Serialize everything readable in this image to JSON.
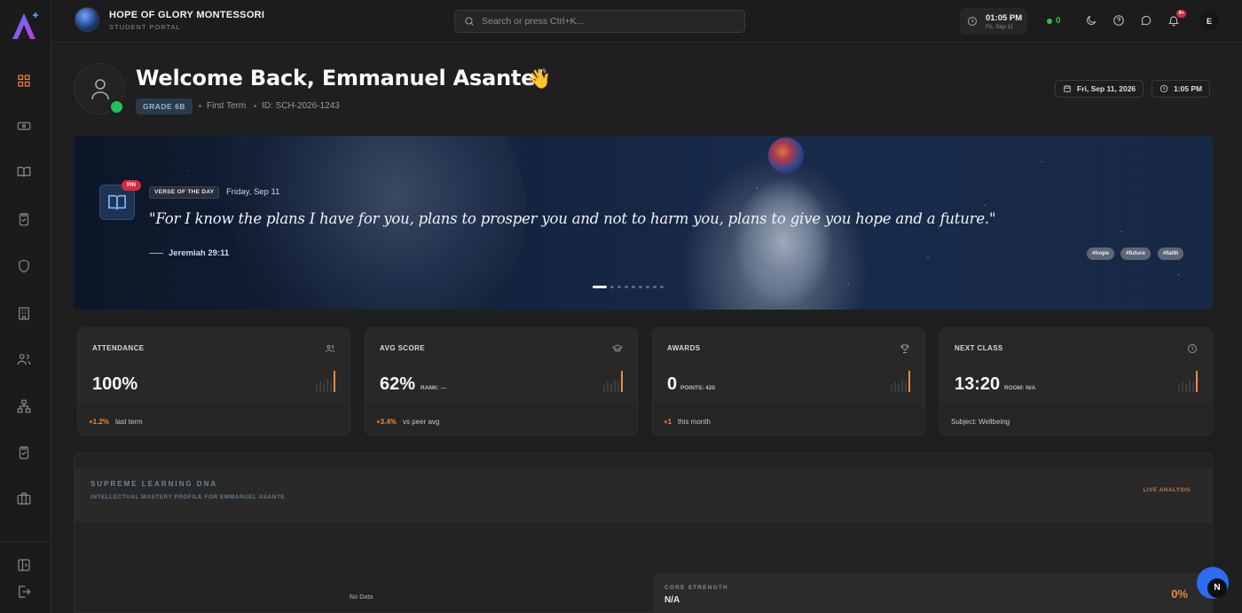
{
  "school": {
    "name": "HOPE OF GLORY MONTESSORI",
    "subtitle": "STUDENT PORTAL"
  },
  "search": {
    "placeholder": "Search or press Ctrl+K..."
  },
  "clock": {
    "time": "01:05 PM",
    "date": "Fri, Sep 11"
  },
  "online": {
    "count": "0"
  },
  "notifications": {
    "badge": "9+"
  },
  "user": {
    "initial": "E"
  },
  "welcome": {
    "greeting": "Welcome Back, Emmanuel Asante!",
    "emoji": "👋",
    "grade": "GRADE 6B",
    "term": "First Term",
    "student_id": "ID: SCH-2026-1243",
    "date_pill": "Fri, Sep 11, 2026",
    "time_pill": "1:05 PM"
  },
  "verse": {
    "pin": "PIN",
    "tag": "VERSE OF THE DAY",
    "date": "Friday, Sep 11",
    "text": "\"For I know the plans I have for you, plans to prosper you and not to harm you, plans to give you hope and a future.\"",
    "reference": "Jeremiah 29:11",
    "hashtags": [
      "#hope",
      "#future",
      "#faith"
    ],
    "slide_count": 9,
    "active_slide": 0
  },
  "stats": [
    {
      "title": "ATTENDANCE",
      "icon": "users-icon",
      "value": "100%",
      "sub": "",
      "delta": "+1.2%",
      "delta_label": "last term"
    },
    {
      "title": "AVG SCORE",
      "icon": "graduation-cap-icon",
      "value": "62%",
      "sub": "RANK: —",
      "delta": "+3.4%",
      "delta_label": "vs peer avg"
    },
    {
      "title": "AWARDS",
      "icon": "trophy-icon",
      "value": "0",
      "sub": "POINTS: 420",
      "delta": "+1",
      "delta_label": "this month"
    },
    {
      "title": "NEXT CLASS",
      "icon": "clock-icon",
      "value": "13:20",
      "sub": "ROOM: N/A",
      "footer": "Subject: Wellbeing"
    }
  ],
  "dna": {
    "title": "SUPREME LEARNING DNA",
    "subtitle": "INTELLECTUAL MASTERY PROFILE FOR EMMANUEL ASANTE",
    "live": "LIVE ANALYSIS",
    "no_data": "No Data",
    "core_title": "CORE STRENGTH",
    "core_value": "N/A",
    "core_pct": "0%"
  },
  "fab": {
    "label": "N"
  },
  "colors": {
    "accent": "#f0883e",
    "online": "#2fbf52",
    "badge": "#d92d3b",
    "fab": "#2a6df0"
  }
}
